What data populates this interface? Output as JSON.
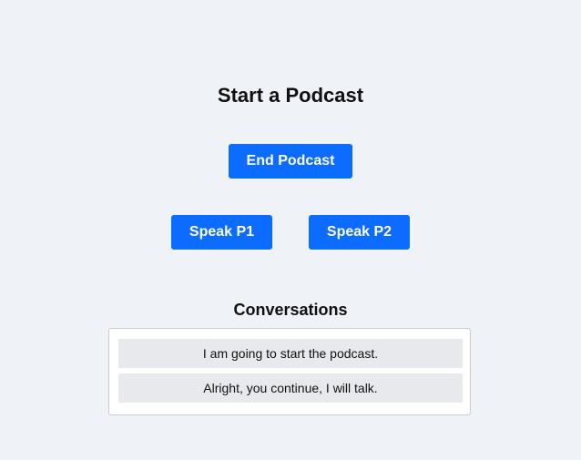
{
  "page": {
    "title": "Start a Podcast"
  },
  "controls": {
    "end_label": "End Podcast",
    "speak_p1_label": "Speak P1",
    "speak_p2_label": "Speak P2"
  },
  "conversations": {
    "heading": "Conversations",
    "messages": [
      "I am going to start the podcast.",
      "Alright, you continue, I will talk."
    ]
  },
  "colors": {
    "accent": "#0b6cff",
    "background": "#eff2f7",
    "message_background": "#e7e9ed"
  }
}
